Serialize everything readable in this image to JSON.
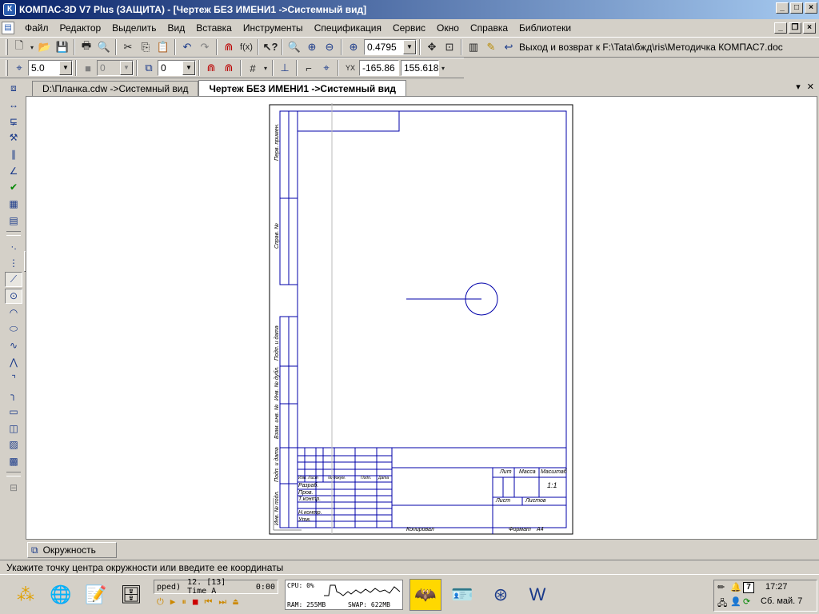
{
  "window": {
    "title": "КОМПАС-3D V7 Plus (ЗАЩИТА) - [Чертеж БЕЗ ИМЕНИ1 ->Системный вид]",
    "app_icon": "kompas-logo-icon"
  },
  "menu": [
    "Файл",
    "Редактор",
    "Выделить",
    "Вид",
    "Вставка",
    "Инструменты",
    "Спецификация",
    "Сервис",
    "Окно",
    "Справка",
    "Библиотеки"
  ],
  "toolbar1": {
    "zoom_value": "0.4795",
    "return_link": "Выход и возврат к F:\\Tata\\бжд\\ris\\Методичка КОМПАС7.doc"
  },
  "toolbar2": {
    "step_value": "5.0",
    "style_value": "0",
    "layer_value": "0",
    "coord_x": "-165.86",
    "coord_y": "155.618"
  },
  "tabs": [
    {
      "label": "D:\\Планка.cdw ->Системный вид",
      "active": false
    },
    {
      "label": "Чертеж БЕЗ ИМЕНИ1 ->Системный вид",
      "active": true
    }
  ],
  "drawing": {
    "stamp_labels": {
      "perv_primen": "Перв. примен.",
      "sprav_no": "Справ. №",
      "podp_data_1": "Подп. и дата",
      "inv_dubl": "Инв. № дубл.",
      "vzam_inv": "Взам. инв. №",
      "podp_data_2": "Подп. и дата",
      "inv_podl": "Инв. № подл.",
      "izm": "Изм. Лист",
      "doc_no": "№ докум.",
      "podp": "Подп.",
      "data": "Дата",
      "razrab": "Разраб.",
      "prov": "Пров.",
      "tkontr": "Т.контр.",
      "nkontr": "Н.контр.",
      "utv": "Утв.",
      "lit": "Лит",
      "massa": "Масса",
      "masshtab": "Масштаб",
      "scale_value": "1:1",
      "list": "Лист",
      "listov": "Листов",
      "kopiroval": "Копировал",
      "format": "Формат",
      "format_value": "А4"
    }
  },
  "object_panel": {
    "label": "Окружность"
  },
  "status": "Укажите точку центра окружности или введите ее координаты",
  "taskbar": {
    "media_text": "pped)",
    "media_track": "12. [13] Time A",
    "media_time": "0:00",
    "cpu": "CPU: 0%",
    "ram": "RAM: 255MB",
    "swap": "SWAP: 622MB",
    "day": "7",
    "clock": "17:27",
    "date": "Сб. май. 7"
  }
}
